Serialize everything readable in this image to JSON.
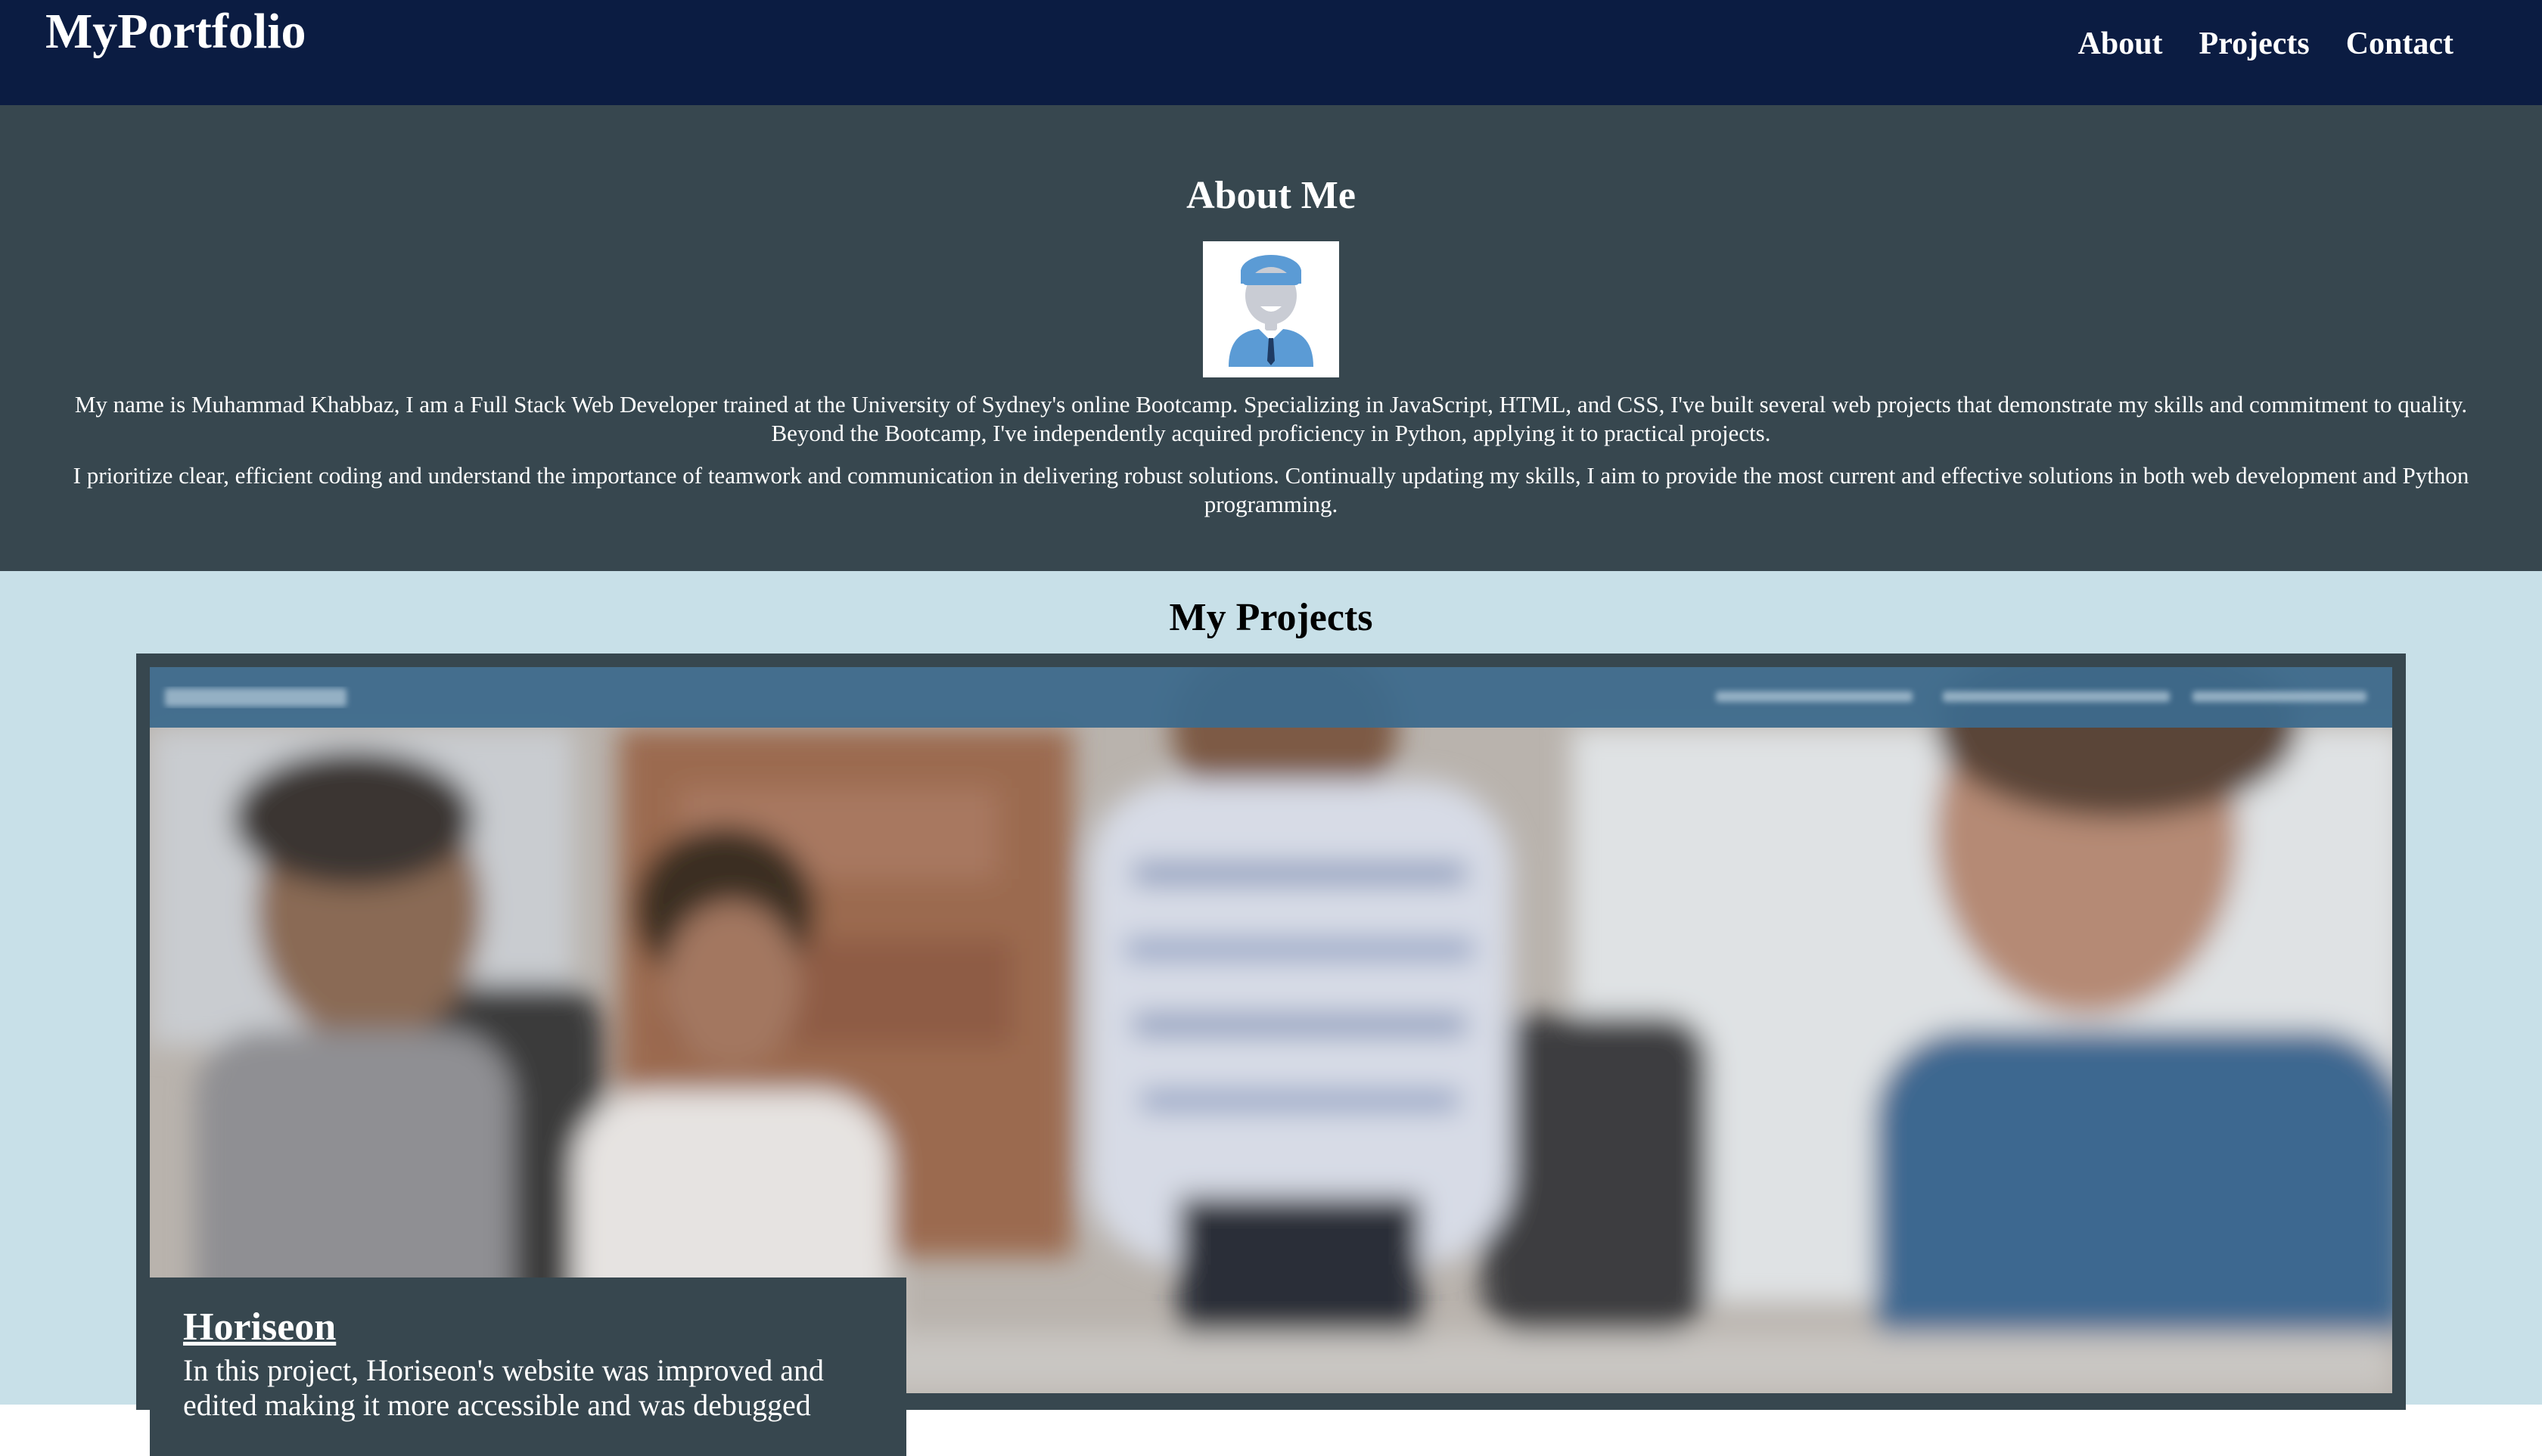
{
  "header": {
    "brand": "MyPortfolio",
    "nav": [
      "About",
      "Projects",
      "Contact"
    ]
  },
  "about": {
    "title": "About Me",
    "avatar_icon": "user-avatar-icon",
    "paragraph1": "My name is Muhammad Khabbaz, I am a Full Stack Web Developer trained at the University of Sydney's online Bootcamp. Specializing in JavaScript, HTML, and CSS, I've built several web projects that demonstrate my skills and commitment to quality. Beyond the Bootcamp, I've independently acquired proficiency in Python, applying it to practical projects.",
    "paragraph2": "I prioritize clear, efficient coding and understand the importance of teamwork and communication in delivering robust solutions. Continually updating my skills, I aim to provide the most current and effective solutions in both web development and Python programming."
  },
  "projects": {
    "title": "My Projects",
    "items": [
      {
        "name": "Horiseon",
        "description": "In this project, Horiseon's website was improved and edited making it more accessible and was debugged"
      }
    ]
  },
  "colors": {
    "header_bg": "#0b1c42",
    "about_bg": "#37474f",
    "projects_bg": "#c8e0e8",
    "avatar_accent": "#5b9bd5"
  }
}
